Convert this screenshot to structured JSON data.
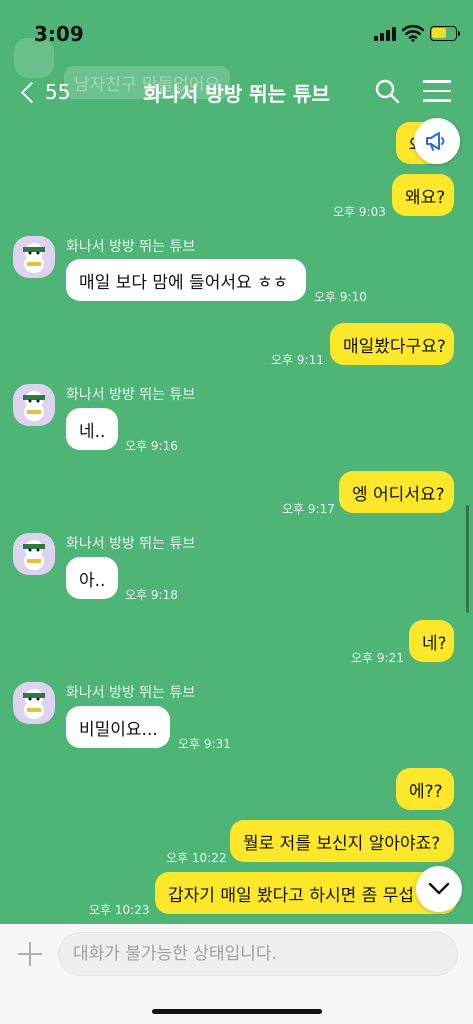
{
  "status": {
    "time": "3:09"
  },
  "header": {
    "back_count": "55",
    "title": "화나서 방방 뛰는 튜브",
    "ghost_text": "남자친구 만들었어요"
  },
  "messages": [
    {
      "from": "me",
      "text": "와요?"
    },
    {
      "from": "me",
      "text": "왜요?",
      "time": "오후 9:03"
    },
    {
      "from": "them",
      "sender": "화나서 방방 뛰는 튜브",
      "text": "매일 보다 맘에 들어서요 ㅎㅎ",
      "time": "오후 9:10"
    },
    {
      "from": "me",
      "text": "매일봤다구요?",
      "time": "오후 9:11"
    },
    {
      "from": "them",
      "sender": "화나서 방방 뛰는 튜브",
      "text": "네..",
      "time": "오후 9:16"
    },
    {
      "from": "me",
      "text": "엥 어디서요?",
      "time": "오후 9:17"
    },
    {
      "from": "them",
      "sender": "화나서 방방 뛰는 튜브",
      "text": "아..",
      "time": "오후 9:18"
    },
    {
      "from": "me",
      "text": "네?",
      "time": "오후 9:21"
    },
    {
      "from": "them",
      "sender": "화나서 방방 뛰는 튜브",
      "text": "비밀이요...",
      "time": "오후 9:31"
    },
    {
      "from": "me",
      "text": "에??"
    },
    {
      "from": "me",
      "text": "뭘로 저를 보신지 알아야죠?",
      "time": "오후 10:22"
    },
    {
      "from": "me",
      "text": "갑자기 매일 봤다고 하시면 좀 무섭",
      "time": "오후 10:23"
    }
  ],
  "input": {
    "placeholder": "대화가 불가능한 상태입니다."
  },
  "icons": {
    "back": "chevron-left-icon",
    "search": "search-icon",
    "menu": "hamburger-menu-icon",
    "notice": "megaphone-icon",
    "scroll_down": "chevron-down-icon",
    "attach": "plus-icon",
    "avatar": "tube-character-avatar"
  },
  "colors": {
    "background": "#4fb576",
    "my_bubble": "#fde72b",
    "their_bubble": "#ffffff"
  }
}
